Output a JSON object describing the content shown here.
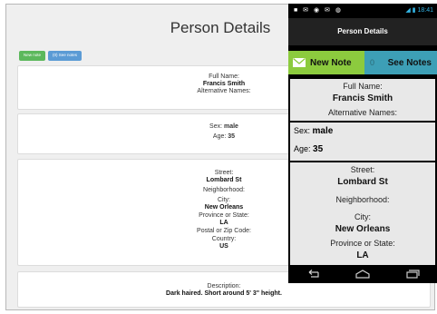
{
  "browser": {
    "title": "Person Details",
    "buttons": {
      "new_note": "New note",
      "see_notes": "(0) See notes"
    },
    "name_card": {
      "full_name_label": "Full Name:",
      "full_name": "Francis Smith",
      "alt_label": "Alternative Names:"
    },
    "sex_card": {
      "sex_label": "Sex:",
      "sex": "male",
      "age_label": "Age:",
      "age": "35"
    },
    "address_card": {
      "street_label": "Street:",
      "street": "Lombard St",
      "neighborhood_label": "Neighborhood:",
      "city_label": "City:",
      "city": "New Orleans",
      "province_label": "Province or State:",
      "province": "LA",
      "postal_label": "Postal or Zip Code:",
      "country_label": "Country:",
      "country": "US"
    },
    "desc_card": {
      "desc_label": "Description:",
      "desc": "Dark haired. Short around 5' 3\" height."
    }
  },
  "phone": {
    "status_time": "18:41",
    "action_title": "Person Details",
    "buttons": {
      "new_note": "New Note",
      "count": "0",
      "see_notes": "See Notes"
    },
    "name_card": {
      "full_name_label": "Full Name:",
      "full_name": "Francis Smith",
      "alt_label": "Alternative Names:"
    },
    "sex_card": {
      "sex_label": "Sex:",
      "sex": "male",
      "age_label": "Age:",
      "age": "35"
    },
    "address_card": {
      "street_label": "Street:",
      "street": "Lombard St",
      "neighborhood_label": "Neighborhood:",
      "city_label": "City:",
      "city": "New Orleans",
      "province_label": "Province or State:",
      "province": "LA"
    }
  },
  "colors": {
    "green": "#8ccb3e",
    "teal": "#3d9fb6",
    "web_green": "#5cb85c",
    "web_blue": "#5b9bd5"
  },
  "icons": [
    "mail-icon",
    "back-icon",
    "home-icon",
    "recent-apps-icon",
    "wifi-icon",
    "battery-icon"
  ]
}
